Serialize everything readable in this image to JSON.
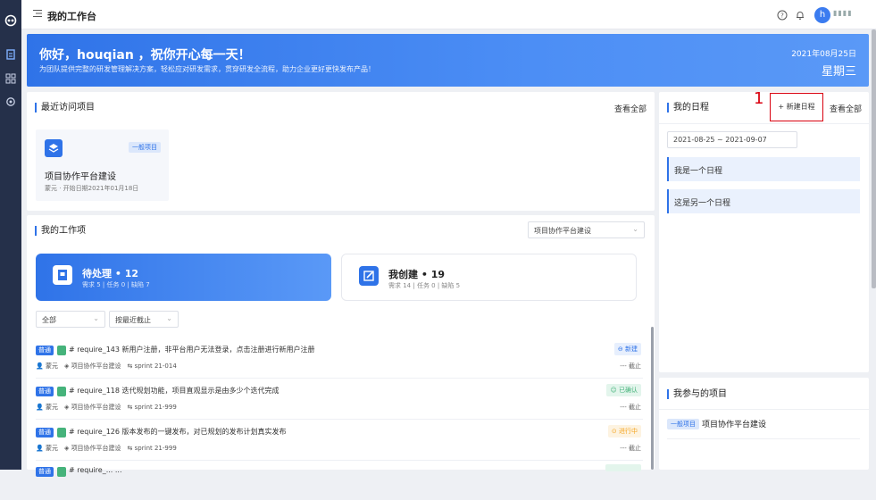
{
  "header": {
    "title": "我的工作台",
    "avatar_letter": "h",
    "user_name": "▮▮▮▮"
  },
  "banner": {
    "greeting": "你好，houqian ，祝你开心每一天！",
    "subtitle": "为团队提供完整的研发管理解决方案，轻松应对研发需求，贯穿研发全流程，助力企业更好更快发布产品！",
    "date": "2021年08月25日",
    "weekday": "星期三"
  },
  "recent": {
    "title": "最近访问项目",
    "view_all": "查看全部",
    "project": {
      "tag": "一般项目",
      "name": "项目协作平台建设",
      "meta": "蒙元 · 开始日期2021年01月18日"
    }
  },
  "work": {
    "title": "我的工作项",
    "project_select": "项目协作平台建设",
    "pending": {
      "title": "待处理 • 12",
      "sub": "需求 5 | 任务 0 | 缺陷 7"
    },
    "created": {
      "title": "我创建 • 19",
      "sub": "需求 14 | 任务 0 | 缺陷 5"
    },
    "filter_all": "全部",
    "filter_sort": "按最近截止",
    "items": [
      {
        "badge": "普通",
        "text": "# require_143 新用户注册，非平台用户无法登录，点击注册进行新用户注册",
        "owner": "蒙元",
        "project": "项目协作平台建设",
        "sprint": "sprint 21-014",
        "status": "新建",
        "due": "--- 截止"
      },
      {
        "badge": "普通",
        "text": "# require_118 迭代规划功能，项目直观显示是由多少个迭代完成",
        "owner": "蒙元",
        "project": "项目协作平台建设",
        "sprint": "sprint 21-999",
        "status": "已确认",
        "due": "--- 截止"
      },
      {
        "badge": "普通",
        "text": "# require_126 版本发布的一键发布，对已规划的发布计划真实发布",
        "owner": "蒙元",
        "project": "项目协作平台建设",
        "sprint": "sprint 21-999",
        "status": "进行中",
        "due": "--- 截止"
      },
      {
        "badge": "普通",
        "text": "# require_... ...",
        "owner": "",
        "project": "",
        "sprint": "",
        "status": "",
        "due": ""
      }
    ]
  },
  "schedule": {
    "title": "我的日程",
    "new_button": "+ 新建日程",
    "view_all": "查看全部",
    "annotation": "1",
    "date_range": "2021-08-25 ~ 2021-09-07",
    "entries": [
      "我是一个日程",
      "这是另一个日程"
    ]
  },
  "joined": {
    "title": "我参与的项目",
    "tag": "一般项目",
    "project": "项目协作平台建设"
  },
  "colors": {
    "accent": "#2f73e8",
    "sidebar": "#25304a",
    "success": "#46b37b",
    "warning": "#f5a623"
  }
}
